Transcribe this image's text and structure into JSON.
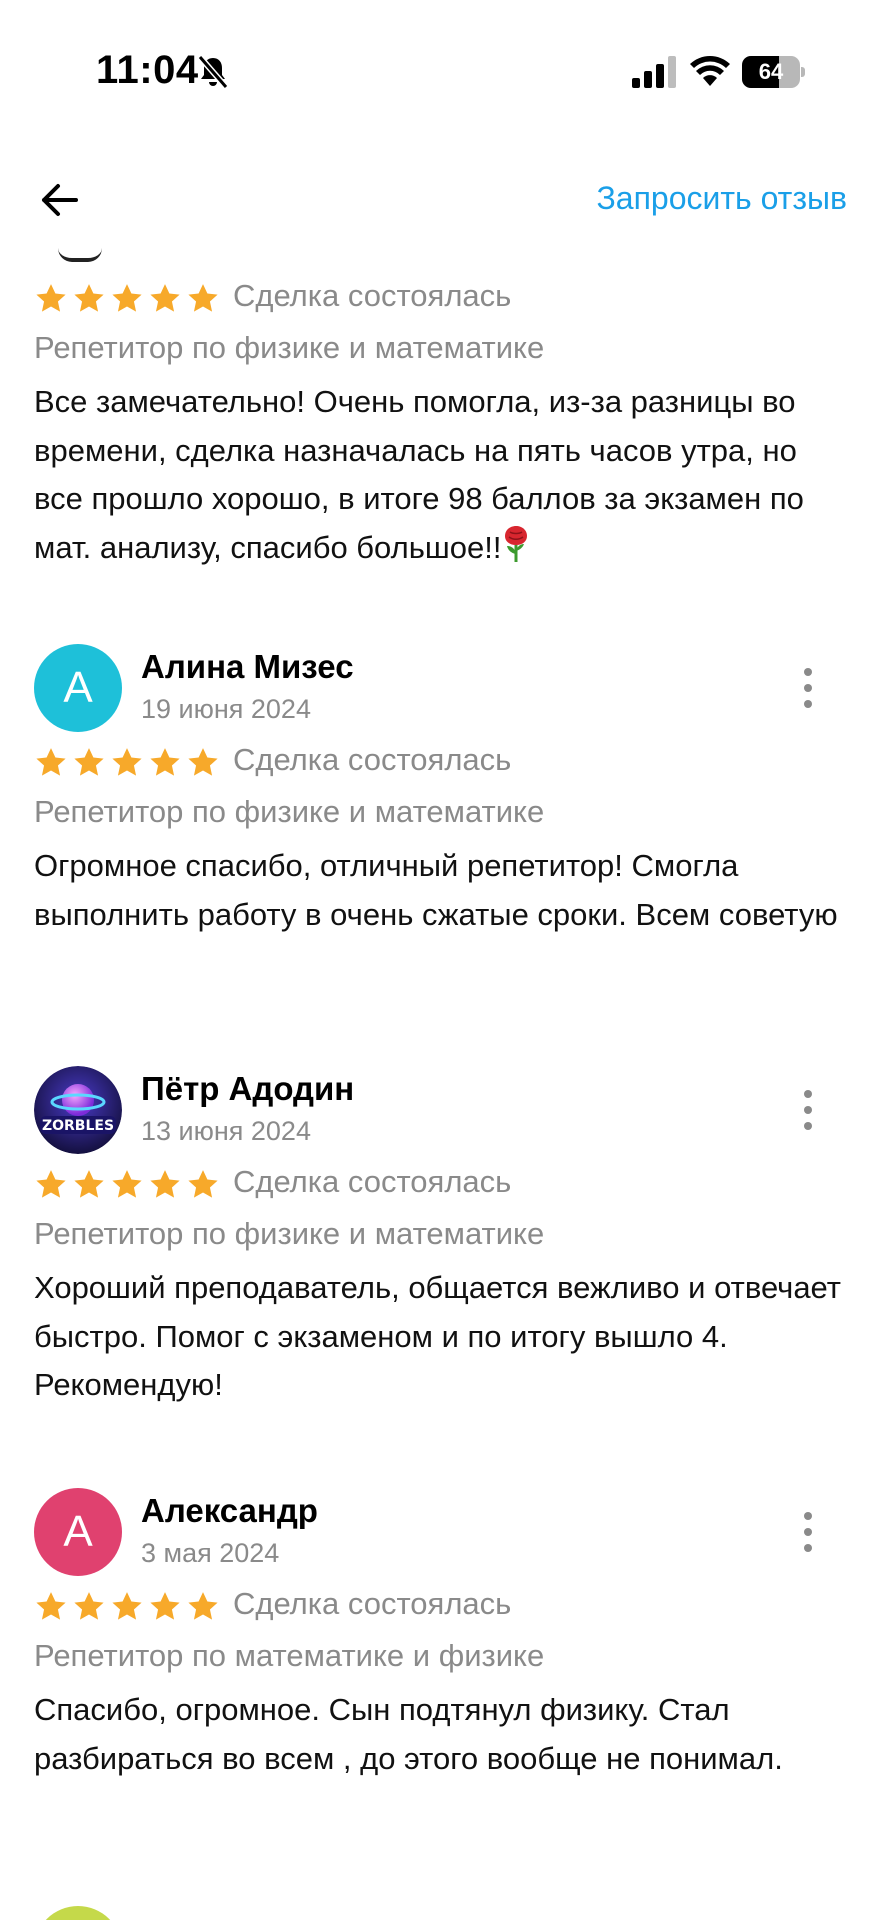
{
  "status_bar": {
    "time": "11:04",
    "battery": "64",
    "battery_level_percent": 64,
    "icons": [
      "bell-muted-icon",
      "signal-icon",
      "wifi-icon",
      "battery-icon"
    ]
  },
  "header": {
    "back_icon": "arrow-left-icon",
    "request_review": "Запросить отзыв"
  },
  "colors": {
    "accent": "#1a9fe8",
    "star": "#f7a92a",
    "muted_text": "#8a8a8a"
  },
  "reviews": [
    {
      "rating": 5,
      "deal_status": "Сделка состоялась",
      "category": "Репетитор по физике и математике",
      "text": "Все замечательно! Очень помогла, из-за разницы во времени, сделка назначалась на пять часов утра, но все прошло хорошо, в итоге 98 баллов за экзамен по мат. анализу, спасибо большое!!"
    },
    {
      "author": "Алина Мизес",
      "initial": "А",
      "avatar_color": "#1ec0d9",
      "date": "19 июня 2024",
      "rating": 5,
      "deal_status": "Сделка состоялась",
      "category": "Репетитор по физике и математике",
      "text": "Огромное спасибо, отличный репетитор! Смогла выполнить работу в очень сжатые сроки. Всем советую"
    },
    {
      "author": "Пётр Адодин",
      "avatar_label": "ZORBLES",
      "date": "13 июня 2024",
      "rating": 5,
      "deal_status": "Сделка состоялась",
      "category": "Репетитор по физике и математике",
      "text": "Хороший преподаватель, общается вежливо и отвечает быстро. Помог с экзаменом и по итогу вышло 4. Рекомендую!"
    },
    {
      "author": "Александр",
      "initial": "А",
      "avatar_color": "#e0416f",
      "date": "3 мая 2024",
      "rating": 5,
      "deal_status": "Сделка состоялась",
      "category": "Репетитор по математике и физике",
      "text": "Спасибо, огромное. Сын подтянул физику. Стал разбираться во всем , до этого вообще не понимал."
    }
  ]
}
